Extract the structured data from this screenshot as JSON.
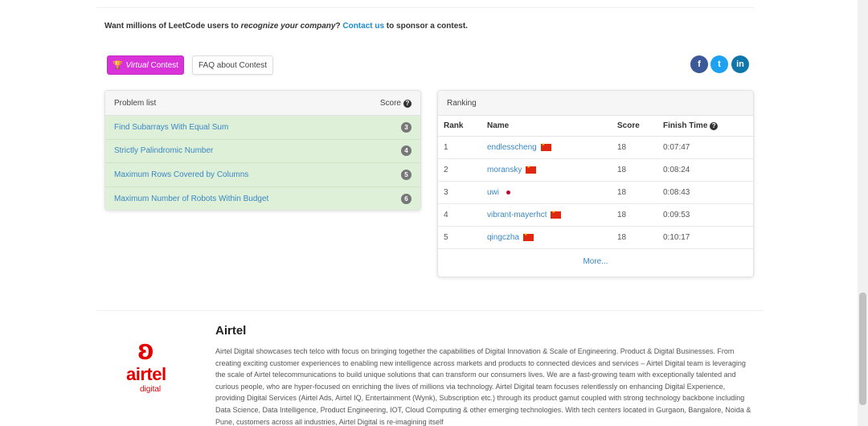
{
  "sponsor": {
    "prefix": "Want millions of LeetCode users to ",
    "emphasis": "recognize your company",
    "middle": "? ",
    "link": "Contact us",
    "suffix": " to sponsor a contest."
  },
  "buttons": {
    "virtual_icon": "trophy-icon",
    "virtual_label": "Virtual",
    "virtual_suffix": " Contest",
    "faq_label": "FAQ about Contest"
  },
  "social": {
    "facebook": "f",
    "twitter": "t",
    "linkedin": "in"
  },
  "problems": {
    "title": "Problem list",
    "score_label": "Score",
    "items": [
      {
        "name": "Find Subarrays With Equal Sum",
        "score": "3"
      },
      {
        "name": "Strictly Palindromic Number",
        "score": "4"
      },
      {
        "name": "Maximum Rows Covered by Columns",
        "score": "5"
      },
      {
        "name": "Maximum Number of Robots Within Budget",
        "score": "6"
      }
    ]
  },
  "ranking": {
    "title": "Ranking",
    "columns": {
      "rank": "Rank",
      "name": "Name",
      "score": "Score",
      "time": "Finish Time"
    },
    "rows": [
      {
        "rank": "1",
        "name": "endlesscheng",
        "flag": "cn",
        "score": "18",
        "time": "0:07:47"
      },
      {
        "rank": "2",
        "name": "moransky",
        "flag": "cn",
        "score": "18",
        "time": "0:08:24"
      },
      {
        "rank": "3",
        "name": "uwi",
        "flag": "jp",
        "score": "18",
        "time": "0:08:43"
      },
      {
        "rank": "4",
        "name": "vibrant-mayerhct",
        "flag": "cn",
        "score": "18",
        "time": "0:09:53"
      },
      {
        "rank": "5",
        "name": "qingczha",
        "flag": "cn",
        "score": "18",
        "time": "0:10:17"
      }
    ],
    "more_label": "More..."
  },
  "sponsor_company": {
    "logo_word": "airtel",
    "logo_sub": "digital",
    "name": "Airtel",
    "description": "Airtel Digital showcases tech telco with focus on bringing together the capabilities of Digital Innovation & Scale of Engineering. Product & Digital Businesses. From creating exciting customer experiences to enabling new intelligence across markets and products to connected devices and services – Airtel Digital team is leveraging the scale of Airtel telecommunications to build unique solutions that can transform our consumers lives. We are a fast-growing team with exceptionally talented and curious people, who are hyper-focused on enriching the lives of millions via technology. Airtel Digital team focuses relentlessly on enhancing Digital Experience, providing Digital Services (Airtel Ads, Airtel IQ, Entertainment (Wynk), Subscription etc.) through its product gamut coupled with strong technology backbone including Data Science, Data Intelligence, Product Engineering, IOT, Cloud Computing & other emerging technologies. With tech centers located in Gurgaon, Bangalore, Noida & Pune, customers across all industries, Airtel Digital is re-imagining itself"
  }
}
